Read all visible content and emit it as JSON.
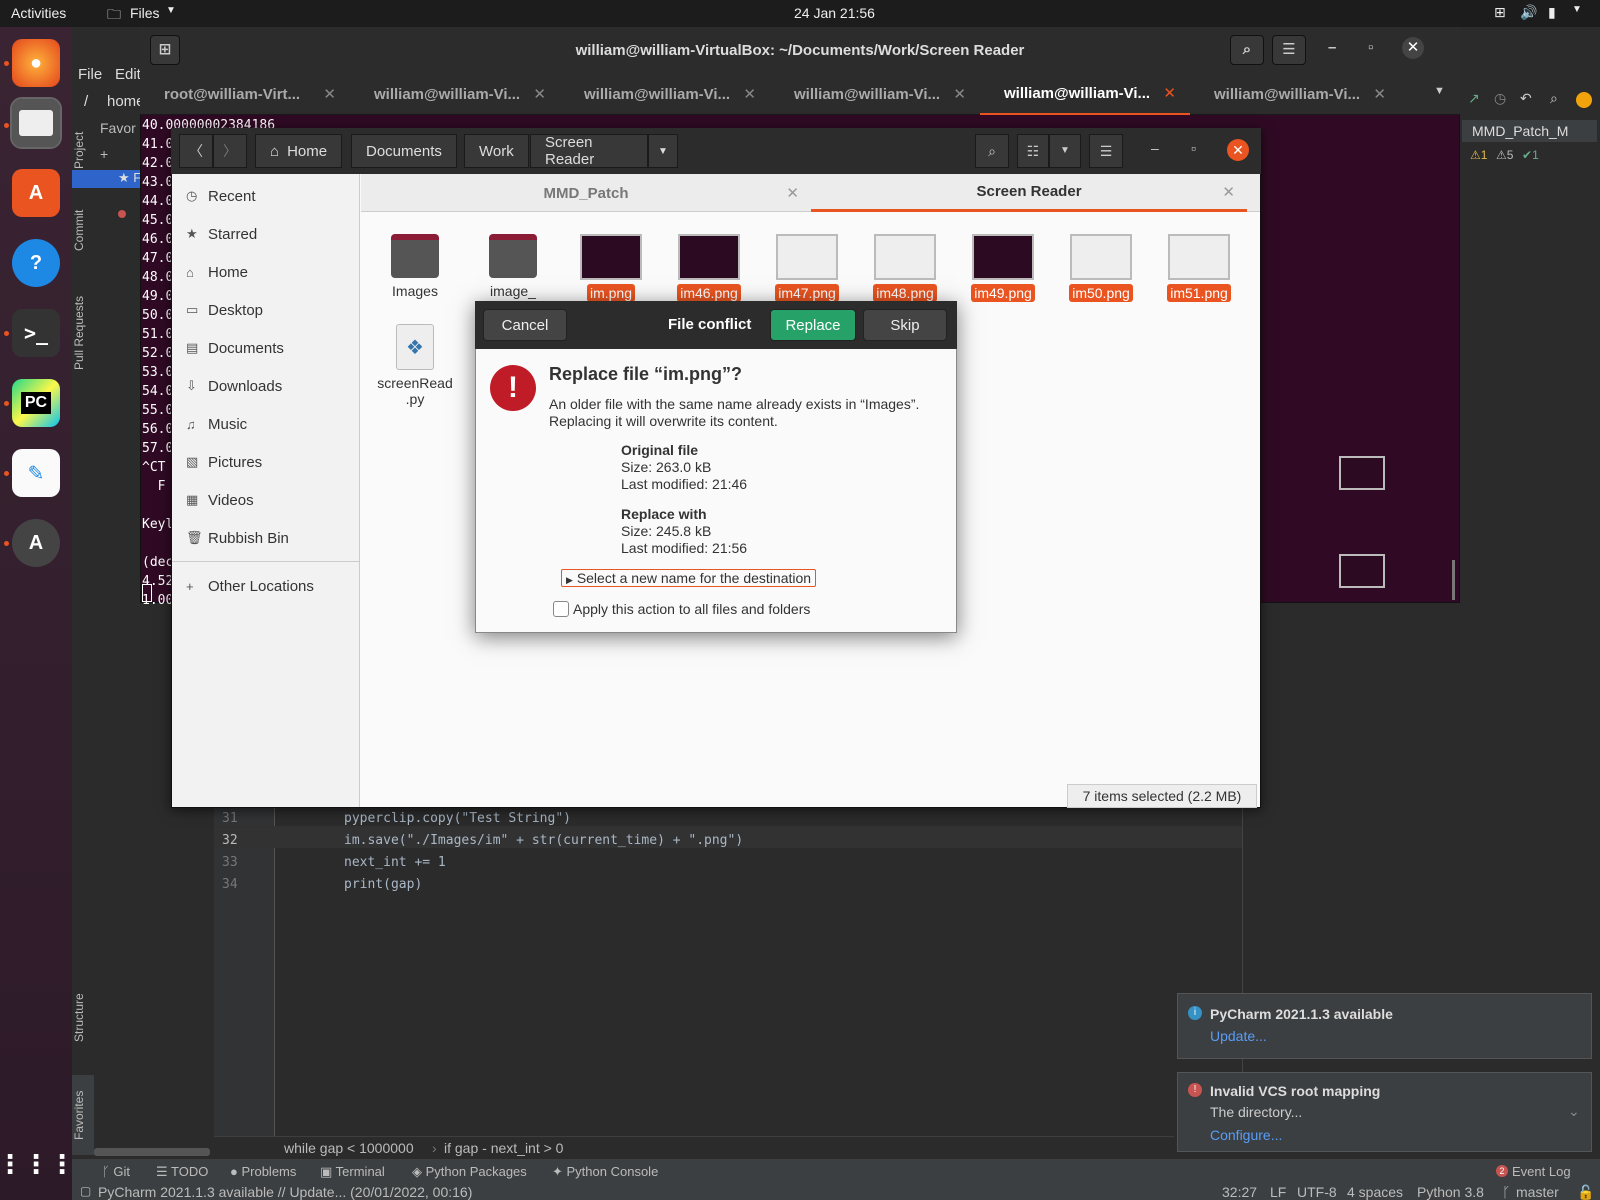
{
  "topbar": {
    "activities": "Activities",
    "app_menu": "Files",
    "clock": "24 Jan  21:56"
  },
  "pycharm": {
    "menu": [
      "File",
      "Edit"
    ],
    "path_frag": "home",
    "favorites_label": "Favor",
    "vertical_tabs": {
      "project": "Project",
      "commit": "Commit",
      "pull_requests": "Pull Requests",
      "structure": "Structure",
      "favorites": "Favorites"
    },
    "run_config": "MMD_Patch_M",
    "inspections": {
      "warnings": "1",
      "weak_warnings": "5",
      "ok": "1"
    },
    "code": [
      {
        "line": "31",
        "text": "pyperclip.copy(\"Test String\")"
      },
      {
        "line": "32",
        "text": "im.save(\"./Images/im\" + str(current_time) + \".png\")"
      },
      {
        "line": "33",
        "text": "next_int += 1"
      },
      {
        "line": "34",
        "text": "print(gap)"
      }
    ],
    "breadcrumb": [
      "while gap < 1000000",
      "if gap - next_int > 0"
    ],
    "tool_tabs": [
      "Git",
      "TODO",
      "Problems",
      "Terminal",
      "Python Packages",
      "Python Console"
    ],
    "event_log": "Event Log",
    "event_count": "2",
    "status_message": "PyCharm 2021.1.3 available // Update... (20/01/2022, 00:16)",
    "status_right": {
      "pos": "32:27",
      "eol": "LF",
      "enc": "UTF-8",
      "indent": "4 spaces",
      "interp": "Python 3.8",
      "branch": "master"
    }
  },
  "notifications": [
    {
      "title": "PyCharm 2021.1.3 available",
      "link": "Update...",
      "body": ""
    },
    {
      "title": "Invalid VCS root mapping",
      "body": "The directory...",
      "link": "Configure..."
    }
  ],
  "terminal": {
    "title": "william@william-VirtualBox: ~/Documents/Work/Screen Reader",
    "tabs": [
      "root@william-Virt...",
      "william@william-Vi...",
      "william@william-Vi...",
      "william@william-Vi...",
      "william@william-Vi...",
      "william@william-Vi..."
    ],
    "first_line": "40.00000002384186",
    "lines": [
      "41.0",
      "42.0",
      "43.0",
      "44.0",
      "45.0",
      "46.0",
      "47.0",
      "48.0",
      "49.0",
      "50.0",
      "51.0",
      "52.0",
      "53.0",
      "54.0",
      "55.0",
      "56.0",
      "57.0",
      "^CT",
      "  F",
      "",
      "Keyl",
      "",
      "(dec",
      "4.52",
      "1.00"
    ]
  },
  "files": {
    "breadcrumb": [
      "Home",
      "Documents",
      "Work",
      "Screen Reader"
    ],
    "sidebar": [
      "Recent",
      "Starred",
      "Home",
      "Desktop",
      "Documents",
      "Downloads",
      "Music",
      "Pictures",
      "Videos",
      "Rubbish Bin",
      "Other Locations"
    ],
    "tabs": [
      "MMD_Patch",
      "Screen Reader"
    ],
    "items": [
      {
        "name": "Images",
        "kind": "folder",
        "selected": false
      },
      {
        "name": "image_",
        "kind": "folder",
        "selected": false
      },
      {
        "name": "im.png",
        "kind": "image",
        "selected": true
      },
      {
        "name": "im46.png",
        "kind": "image",
        "selected": true
      },
      {
        "name": "im47.png",
        "kind": "image",
        "selected": true
      },
      {
        "name": "im48.png",
        "kind": "image",
        "selected": true
      },
      {
        "name": "im49.png",
        "kind": "image",
        "selected": true
      },
      {
        "name": "im50.png",
        "kind": "image",
        "selected": true
      },
      {
        "name": "im51.png",
        "kind": "image",
        "selected": true
      }
    ],
    "script_file": "screenRead\n.py",
    "status": "7 items selected (2.2 MB)"
  },
  "dialog": {
    "cancel": "Cancel",
    "title": "File conflict",
    "replace": "Replace",
    "skip": "Skip",
    "heading": "Replace file “im.png”?",
    "message": "An older file with the same name already exists in “Images”.\nReplacing it will overwrite its content.",
    "original": {
      "label": "Original file",
      "size": "Size: 263.0 kB",
      "modified": "Last modified: 21:46"
    },
    "replacement": {
      "label": "Replace with",
      "size": "Size: 245.8 kB",
      "modified": "Last modified: 21:56"
    },
    "rename": "Select a new name for the destination",
    "apply_all": "Apply this action to all files and folders"
  }
}
